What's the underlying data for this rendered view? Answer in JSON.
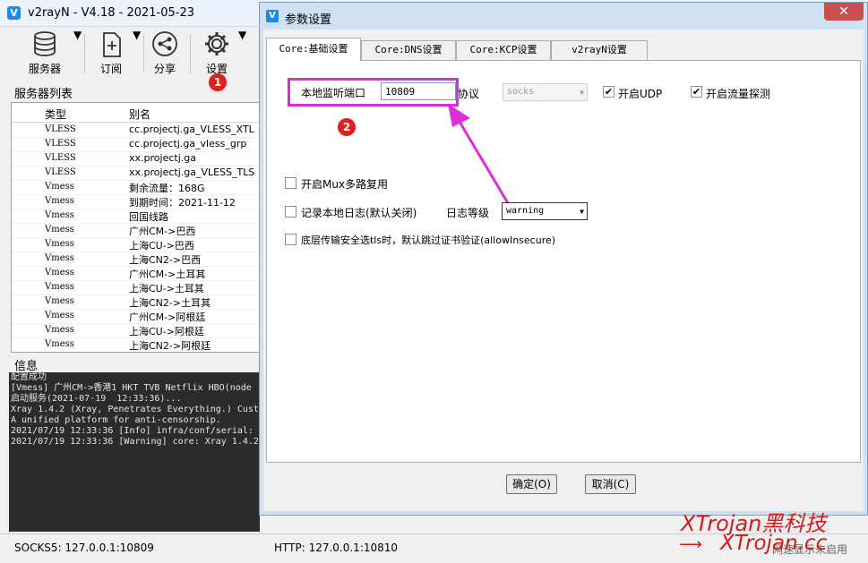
{
  "main_window": {
    "title": "v2rayN - V4.18 - 2021-05-23",
    "toolbar": [
      {
        "label": "服务器",
        "icon": "database-icon"
      },
      {
        "label": "订阅",
        "icon": "subscribe-icon"
      },
      {
        "label": "分享",
        "icon": "share-icon"
      },
      {
        "label": "设置",
        "icon": "gear-icon"
      }
    ],
    "server_list_label": "服务器列表",
    "columns": [
      "类型",
      "别名"
    ],
    "rows": [
      {
        "type": "VLESS",
        "alias": "cc.projectj.ga_VLESS_XTL"
      },
      {
        "type": "VLESS",
        "alias": "cc.projectj.ga_vless_grp"
      },
      {
        "type": "VLESS",
        "alias": "xx.projectj.ga"
      },
      {
        "type": "VLESS",
        "alias": "xx.projectj.ga_VLESS_TLS"
      },
      {
        "type": "Vmess",
        "alias": "剩余流量：168G"
      },
      {
        "type": "Vmess",
        "alias": "到期时间：2021-11-12"
      },
      {
        "type": "Vmess",
        "alias": "回国线路"
      },
      {
        "type": "Vmess",
        "alias": "广州CM->巴西"
      },
      {
        "type": "Vmess",
        "alias": "上海CU->巴西"
      },
      {
        "type": "Vmess",
        "alias": "上海CN2->巴西"
      },
      {
        "type": "Vmess",
        "alias": "广州CM->土耳其"
      },
      {
        "type": "Vmess",
        "alias": "上海CU->土耳其"
      },
      {
        "type": "Vmess",
        "alias": "上海CN2->土耳其"
      },
      {
        "type": "Vmess",
        "alias": "广州CM->阿根廷"
      },
      {
        "type": "Vmess",
        "alias": "上海CU->阿根廷"
      },
      {
        "type": "Vmess",
        "alias": "上海CN2->阿根廷"
      }
    ],
    "info_label": "信息",
    "console_lines": [
      "配置成功",
      "[Vmess] 广州CM->香港1 HKT TVB Netflix HBO(node",
      "启动服务(2021-07-19  12:33:36)...",
      "Xray 1.4.2 (Xray, Penetrates Everything.) Cust",
      "A unified platform for anti-censorship.",
      "2021/07/19 12:33:36 [Info] infra/conf/serial:",
      "2021/07/19 12:33:36 [Warning] core: Xray 1.4.2"
    ],
    "status": {
      "socks": "SOCKS5:  127.0.0.1:10809",
      "http": "HTTP:  127.0.0.1:10810",
      "right": "网速显示未启用"
    }
  },
  "dialog": {
    "title": "参数设置",
    "close_glyph": "✕",
    "tabs": [
      "Core:基础设置",
      "Core:DNS设置",
      "Core:KCP设置",
      "v2rayN设置"
    ],
    "port_label": "本地监听端口",
    "port_value": "10809",
    "protocol_label": "协议",
    "protocol_value": "socks",
    "udp_label": "开启UDP",
    "sniff_label": "开启流量探测",
    "mux_label": "开启Mux多路复用",
    "log_label": "记录本地日志(默认关闭)",
    "log_level_label": "日志等级",
    "log_level_value": "warning",
    "insecure_label": "底层传输安全选tls时，默认跳过证书验证(allowInsecure)",
    "ok_button": "确定(O)",
    "cancel_button": "取消(C)",
    "checked_glyph": "✔"
  },
  "annotations": {
    "badge1": "1",
    "badge2": "2",
    "highlight_color": "#d92ed9",
    "badge_color": "#e02020"
  },
  "watermark": {
    "line1": "XTrojan黑科技",
    "line2": "XTrojan.cc",
    "arrow": "⟶"
  }
}
